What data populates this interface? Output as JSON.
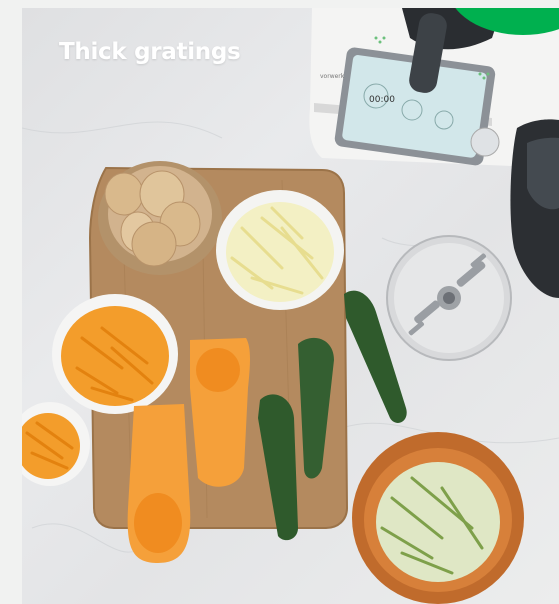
{
  "card": {
    "title": "Thick gratings",
    "device_time": "00:00"
  },
  "colors": {
    "badge": "#00b04f",
    "title_text": "#ffffff",
    "background": "#f1f2f1"
  },
  "icons": {
    "badge": "green-circle-badge"
  }
}
